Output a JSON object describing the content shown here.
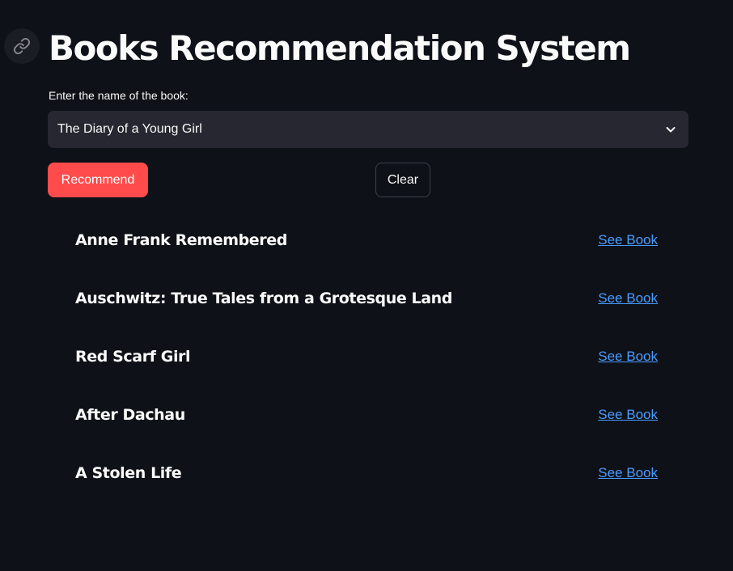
{
  "header": {
    "title": "Books Recommendation System",
    "anchor_icon": "link-icon"
  },
  "book_select": {
    "label": "Enter the name of the book:",
    "selected_value": "The Diary of a Young Girl",
    "icon": "chevron-down-icon"
  },
  "actions": {
    "recommend_label": "Recommend",
    "clear_label": "Clear"
  },
  "results": [
    {
      "title": "Anne Frank Remembered",
      "link_label": "See Book"
    },
    {
      "title": "Auschwitz: True Tales from a Grotesque Land",
      "link_label": "See Book"
    },
    {
      "title": "Red Scarf Girl",
      "link_label": "See Book"
    },
    {
      "title": "After Dachau",
      "link_label": "See Book"
    },
    {
      "title": "A Stolen Life",
      "link_label": "See Book"
    }
  ],
  "colors": {
    "background": "#0e1117",
    "primary_button": "#ff4b4b",
    "link": "#4a9cff",
    "select_background": "#262730"
  }
}
